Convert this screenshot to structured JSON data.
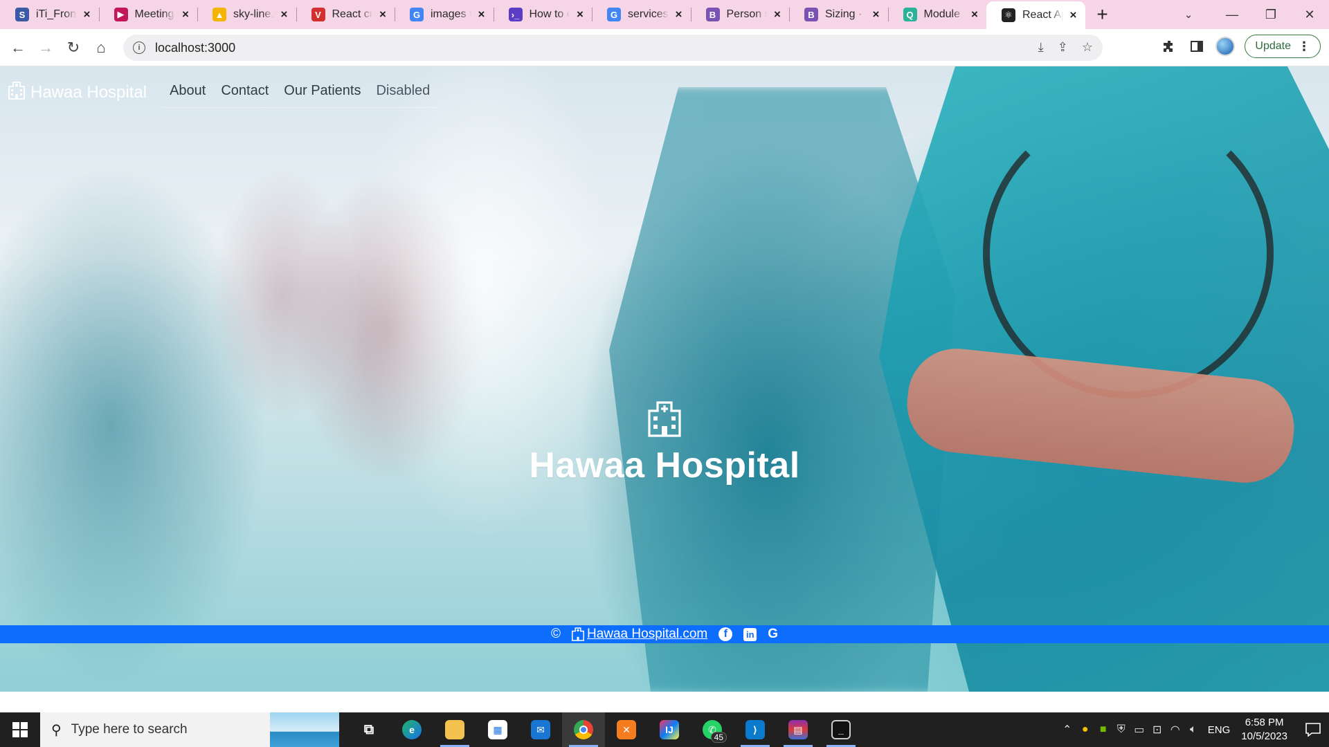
{
  "browser": {
    "tabs": [
      {
        "title": "iTi_Front",
        "favicon_color": "#3a5aa8",
        "favicon_glyph": "S"
      },
      {
        "title": "Meeting",
        "favicon_color": "#c2185b",
        "favicon_glyph": "▶"
      },
      {
        "title": "sky-line.z",
        "favicon_color": "#f4b400",
        "favicon_glyph": "▲"
      },
      {
        "title": "React cre",
        "favicon_color": "#d32f2f",
        "favicon_glyph": "V"
      },
      {
        "title": "images f",
        "favicon_color": "#4285f4",
        "favicon_glyph": "G"
      },
      {
        "title": "How to c",
        "favicon_color": "#5b3cc4",
        "favicon_glyph": "›_"
      },
      {
        "title": "services",
        "favicon_color": "#4285f4",
        "favicon_glyph": "G"
      },
      {
        "title": "Person s",
        "favicon_color": "#7952b3",
        "favicon_glyph": "B"
      },
      {
        "title": "Sizing · B",
        "favicon_color": "#7952b3",
        "favicon_glyph": "B"
      },
      {
        "title": "Module",
        "favicon_color": "#2bb39a",
        "favicon_glyph": "Q"
      },
      {
        "title": "React Ap",
        "favicon_color": "#222222",
        "favicon_glyph": "⚛"
      }
    ],
    "active_tab_index": 10,
    "url": "localhost:3000",
    "update_label": "Update"
  },
  "page": {
    "brand": "Hawaa Hospital",
    "nav": [
      {
        "label": "About",
        "disabled": false
      },
      {
        "label": "Contact",
        "disabled": false
      },
      {
        "label": "Our Patients",
        "disabled": false
      },
      {
        "label": "Disabled",
        "disabled": true
      }
    ],
    "hero_title": "Hawaa Hospital",
    "footer": {
      "copyright": "©",
      "link_text": "Hawaa Hospital.com",
      "social": [
        "facebook-icon",
        "linkedin-icon",
        "google-icon"
      ]
    }
  },
  "taskbar": {
    "search_placeholder": "Type here to search",
    "whatsapp_badge": "45",
    "language": "ENG",
    "time": "6:58 PM",
    "date": "10/5/2023"
  }
}
